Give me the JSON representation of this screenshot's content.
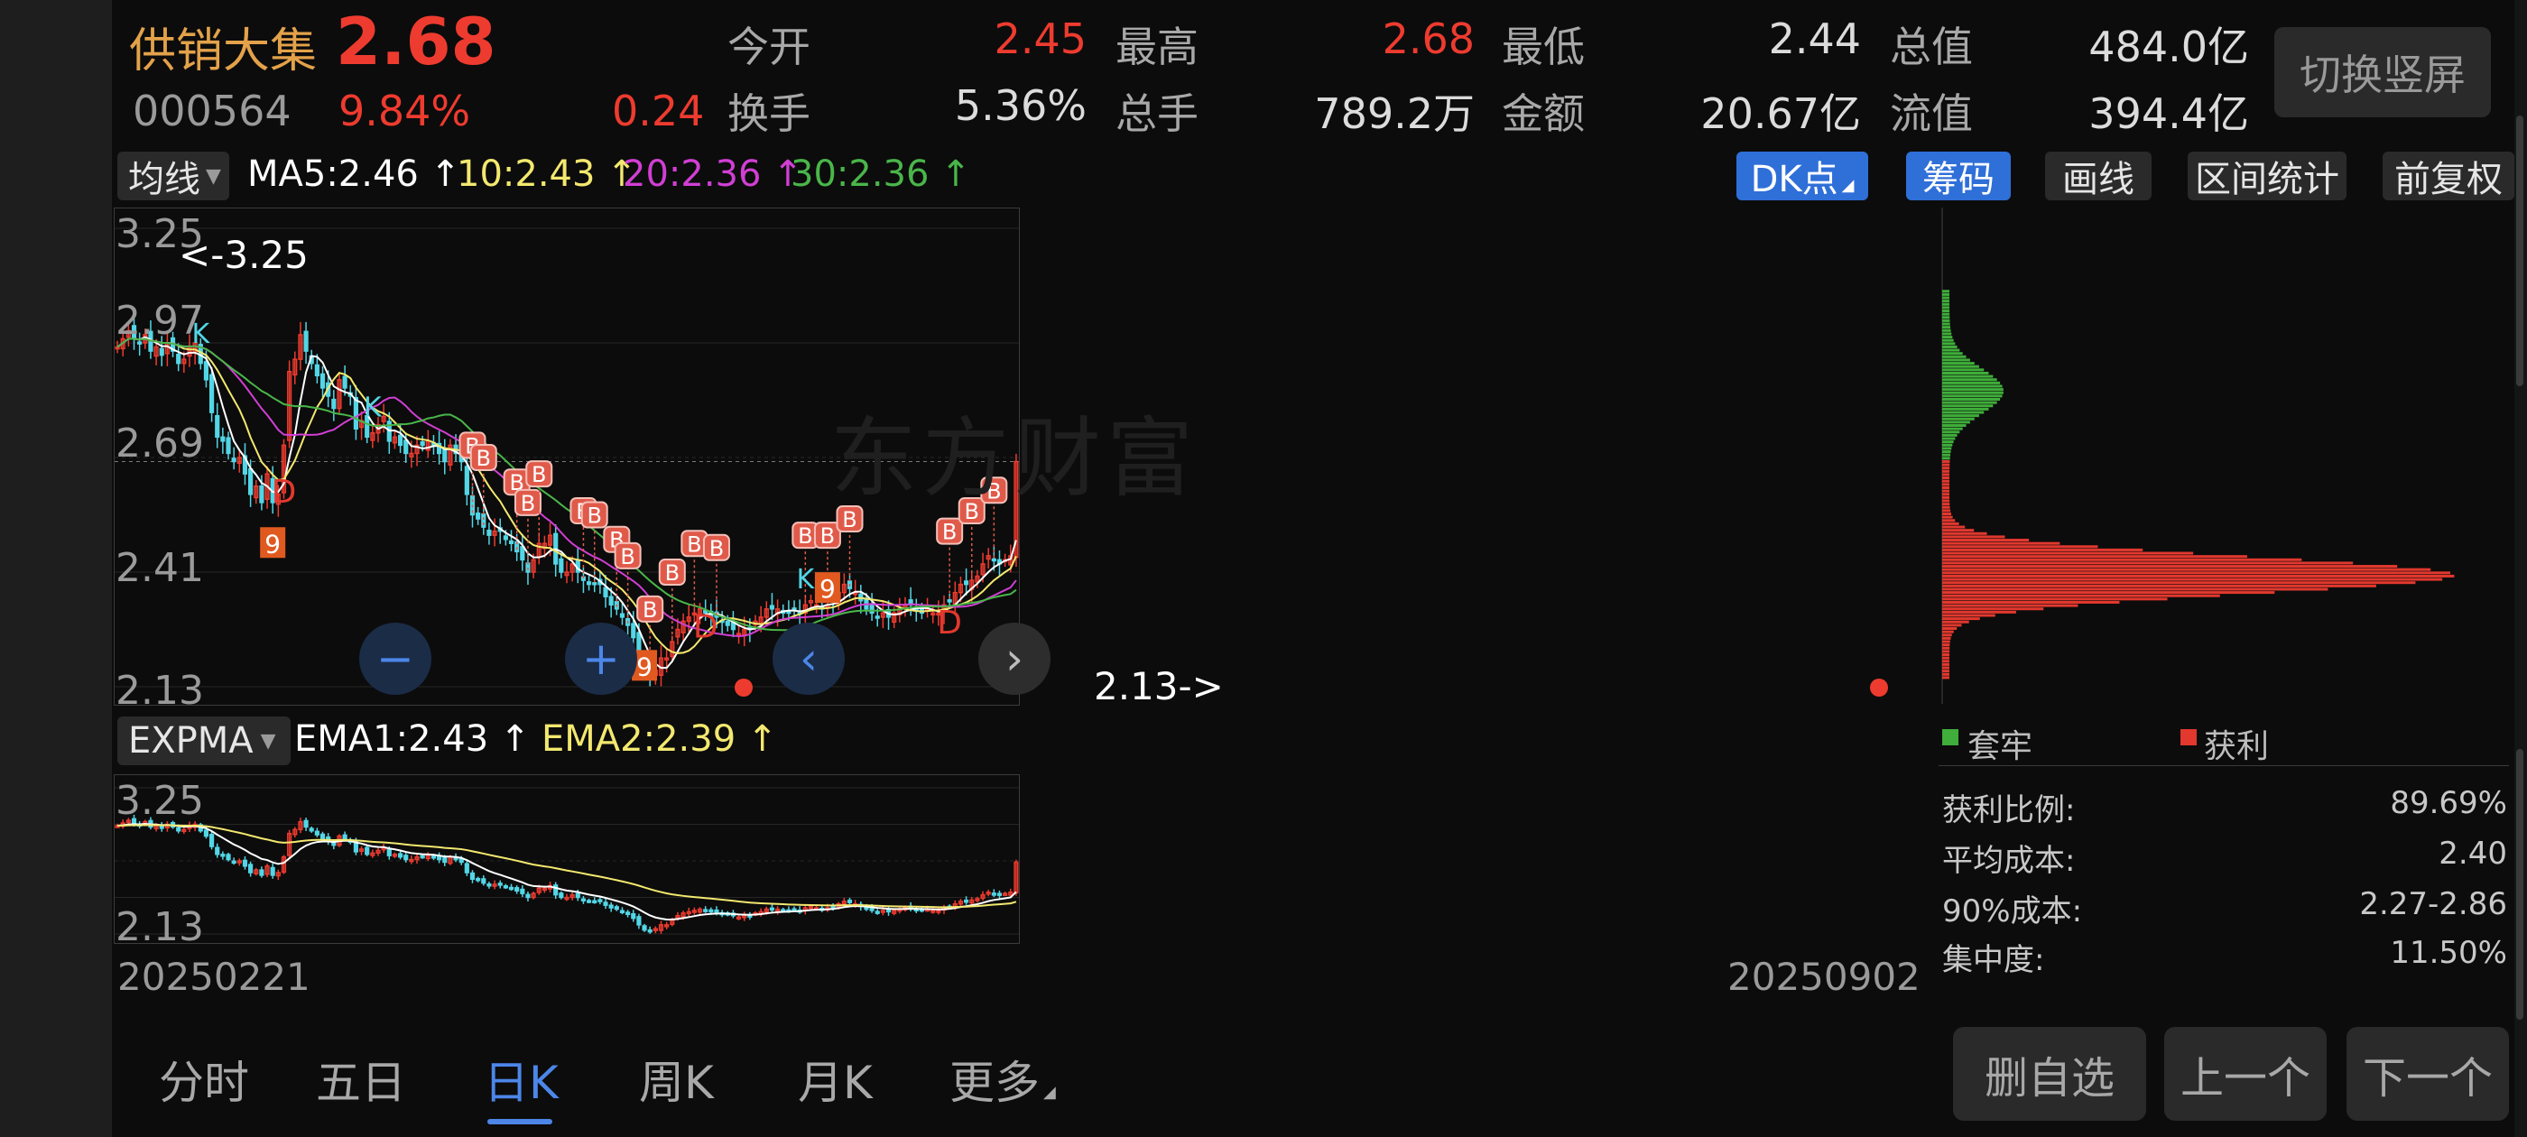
{
  "header": {
    "name": "供销大集",
    "price": "2.68",
    "code": "000564",
    "pct": "9.84%",
    "change": "0.24",
    "stats": [
      {
        "label": "今开",
        "value": "2.45",
        "color": "red"
      },
      {
        "label": "最高",
        "value": "2.68",
        "color": "red"
      },
      {
        "label": "最低",
        "value": "2.44",
        "color": "white"
      },
      {
        "label": "总值",
        "value": "484.0亿",
        "color": "white"
      },
      {
        "label": "换手",
        "value": "5.36%",
        "color": "white"
      },
      {
        "label": "总手",
        "value": "789.2万",
        "color": "white"
      },
      {
        "label": "金额",
        "value": "20.67亿",
        "color": "white"
      },
      {
        "label": "流值",
        "value": "394.4亿",
        "color": "white"
      }
    ],
    "switch_label": "切换竖屏"
  },
  "ma_bar": {
    "selector": "均线",
    "ma5": "MA5:2.46 ↑",
    "ma10": "10:2.43 ↑",
    "ma20": "20:2.36 ↑",
    "ma30": "30:2.36 ↑",
    "buttons": [
      "DK点",
      "筹码",
      "画线",
      "区间统计",
      "前复权"
    ]
  },
  "colors": {
    "up": "#ee3b2f",
    "down": "#53d6e6",
    "ma5": "#ffffff",
    "ma10": "#f3e86f",
    "ma20": "#d13fd4",
    "ma30": "#49b649",
    "accent": "#2f6fd8"
  },
  "main_chart": {
    "ticks": [
      "3.25",
      "2.97",
      "2.69",
      "2.41",
      "2.13"
    ],
    "max_label": "<-3.25",
    "min_label": "2.13->",
    "markers": {
      "b": "B",
      "d": "D",
      "k": "K",
      "nine": "9"
    }
  },
  "chart_data": {
    "type": "candlestick",
    "ylim": [
      2.13,
      3.25
    ],
    "ma_periods": [
      5,
      10,
      20,
      30
    ],
    "date_range": [
      "20250221",
      "20250902"
    ],
    "close": [
      2.96,
      2.98,
      3.0,
      2.98,
      2.97,
      2.99,
      2.95,
      2.96,
      2.94,
      2.97,
      2.95,
      2.92,
      2.93,
      2.96,
      2.97,
      2.92,
      2.88,
      2.8,
      2.74,
      2.73,
      2.7,
      2.68,
      2.69,
      2.65,
      2.6,
      2.62,
      2.58,
      2.65,
      2.58,
      2.6,
      2.72,
      2.9,
      2.93,
      2.99,
      2.95,
      2.92,
      2.89,
      2.86,
      2.84,
      2.81,
      2.88,
      2.86,
      2.84,
      2.76,
      2.78,
      2.74,
      2.75,
      2.77,
      2.79,
      2.73,
      2.74,
      2.72,
      2.7,
      2.7,
      2.72,
      2.72,
      2.73,
      2.72,
      2.7,
      2.68,
      2.72,
      2.7,
      2.68,
      2.6,
      2.55,
      2.54,
      2.52,
      2.5,
      2.51,
      2.51,
      2.49,
      2.48,
      2.46,
      2.44,
      2.41,
      2.44,
      2.48,
      2.48,
      2.5,
      2.43,
      2.41,
      2.41,
      2.43,
      2.41,
      2.39,
      2.38,
      2.38,
      2.38,
      2.35,
      2.33,
      2.32,
      2.3,
      2.28,
      2.25,
      2.2,
      2.16,
      2.15,
      2.17,
      2.2,
      2.2,
      2.24,
      2.27,
      2.29,
      2.3,
      2.31,
      2.32,
      2.31,
      2.3,
      2.3,
      2.29,
      2.28,
      2.27,
      2.26,
      2.27,
      2.27,
      2.29,
      2.3,
      2.32,
      2.32,
      2.32,
      2.31,
      2.31,
      2.32,
      2.31,
      2.33,
      2.34,
      2.33,
      2.32,
      2.33,
      2.34,
      2.36,
      2.38,
      2.37,
      2.36,
      2.34,
      2.32,
      2.31,
      2.3,
      2.31,
      2.3,
      2.31,
      2.32,
      2.33,
      2.33,
      2.32,
      2.31,
      2.32,
      2.31,
      2.31,
      2.33,
      2.34,
      2.36,
      2.38,
      2.38,
      2.39,
      2.4,
      2.43,
      2.45,
      2.44,
      2.43,
      2.44,
      2.45,
      2.68
    ]
  },
  "indicator": {
    "selector": "EXPMA",
    "ema1": "EMA1:2.43 ↑",
    "ema2": "EMA2:2.39 ↑",
    "ticks": [
      "3.25",
      "2.13"
    ],
    "date_start": "20250221",
    "date_end": "20250902"
  },
  "distribution": {
    "legend_trapped": "套牢",
    "legend_profit": "获利",
    "trapped_color": "#3fae3a",
    "profit_color": "#e2382e",
    "stats": [
      {
        "label": "获利比例:",
        "value": "89.69%"
      },
      {
        "label": "平均成本:",
        "value": "2.40"
      },
      {
        "label": "90%成本:",
        "value": "2.27-2.86"
      },
      {
        "label": "集中度:",
        "value": "11.50%"
      }
    ]
  },
  "bottom_tabs": [
    "分时",
    "五日",
    "日K",
    "周K",
    "月K",
    "更多"
  ],
  "active_tab": "日K",
  "bottom_buttons": [
    "删自选",
    "上一个",
    "下一个"
  ],
  "watermark": "东方财富"
}
